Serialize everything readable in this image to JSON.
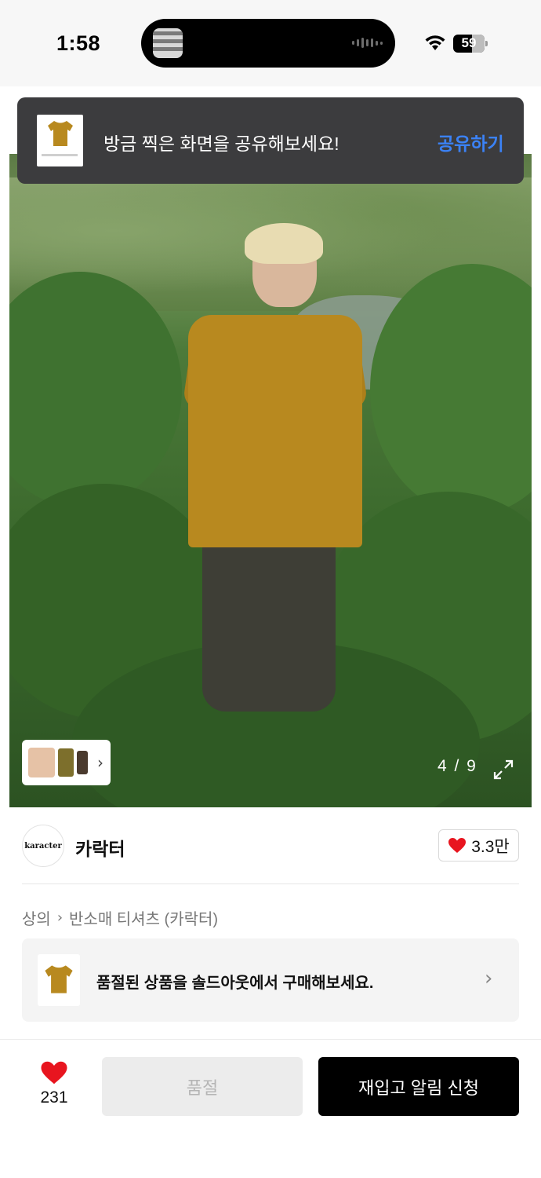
{
  "status_bar": {
    "time": "1:58",
    "battery_level": "59"
  },
  "toast": {
    "message": "방금 찍은 화면을 공유해보세요!",
    "action_label": "공유하기",
    "action_color": "#3b82f6"
  },
  "gallery": {
    "page_counter": "4 / 9",
    "current_image": 4,
    "total_images": 9
  },
  "brand": {
    "logo_text": "karacter",
    "name": "카락터",
    "like_count": "3.3만"
  },
  "breadcrumb": {
    "category": "상의",
    "subcategory": "반소매 티셔츠 (카락터)"
  },
  "soldout_banner": {
    "text": "품절된 상품을 솔드아웃에서 구매해보세요."
  },
  "bottom_bar": {
    "wish_count": "231",
    "soldout_label": "품절",
    "restock_label": "재입고 알림 신청"
  },
  "colors": {
    "like_red": "#e8151f",
    "primary_black": "#000000",
    "disabled_gray": "#ececec",
    "shirt_mustard": "#b8891f"
  },
  "icons": {
    "wifi": "wifi-icon",
    "battery": "battery-icon",
    "heart": "heart-icon",
    "chevron": "chevron-right-icon",
    "expand": "expand-icon"
  }
}
